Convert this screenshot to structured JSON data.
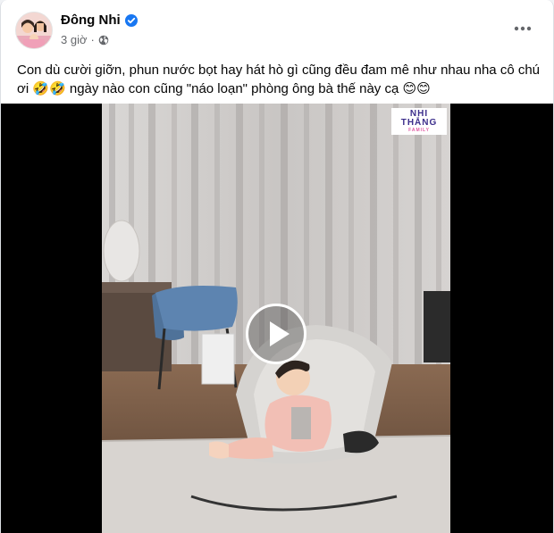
{
  "post": {
    "author": "Đông Nhi",
    "time": "3 giờ",
    "caption": "Con dù cười giỡn, phun nước bọt hay hát hò gì cũng đều đam mê như nhau nha cô chú ơi 🤣🤣 ngày nào con cũng \"náo loạn\" phòng ông bà thế này cạ 😊😊"
  },
  "video": {
    "watermark_line1": "NHI",
    "watermark_line2": "THẮNG",
    "watermark_line3": "FAMILY"
  },
  "icons": {
    "verified": "verified-badge-icon",
    "audience": "globe-icon",
    "more": "more-options-icon",
    "play": "play-icon"
  },
  "colors": {
    "verified_blue": "#1877f2",
    "text_primary": "#050505",
    "text_secondary": "#65676b",
    "video_bg": "#000000"
  }
}
